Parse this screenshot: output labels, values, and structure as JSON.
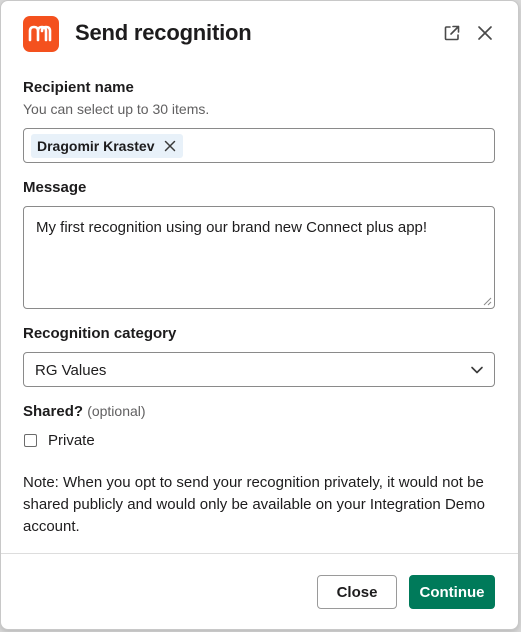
{
  "modal": {
    "title": "Send recognition"
  },
  "recipient": {
    "label": "Recipient name",
    "hint": "You can select up to 30 items.",
    "selected": "Dragomir Krastev"
  },
  "message": {
    "label": "Message",
    "value": "My first recognition using our brand new Connect plus app!"
  },
  "category": {
    "label": "Recognition category",
    "selected": "RG Values"
  },
  "shared": {
    "label": "Shared?",
    "optional": "(optional)",
    "option_label": "Private",
    "checked": false
  },
  "note": "Note: When you opt to send your recognition privately, it would not be shared publicly and would only be available on your Integration Demo account.",
  "footer": {
    "close_label": "Close",
    "continue_label": "Continue"
  },
  "colors": {
    "logo": "#f4511e",
    "primary_button": "#007a5a",
    "chip_background": "#e8f1f9"
  },
  "icons": {
    "logo": "app-logo-icon",
    "open_external": "external-link-icon",
    "close": "close-icon",
    "chip_remove": "remove-icon",
    "select": "chevron-down-icon"
  }
}
